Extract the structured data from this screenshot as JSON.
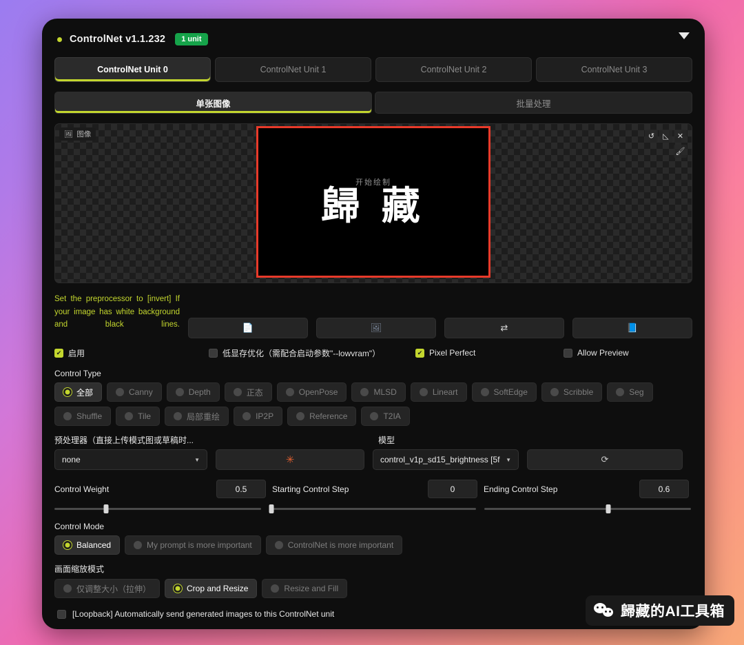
{
  "header": {
    "title": "ControlNet v1.1.232",
    "badge": "1 unit",
    "status_dot_color": "#c3d62e",
    "collapse_icon": "chevron-down-icon"
  },
  "unit_tabs": [
    {
      "label": "ControlNet Unit 0",
      "active": true
    },
    {
      "label": "ControlNet Unit 1",
      "active": false
    },
    {
      "label": "ControlNet Unit 2",
      "active": false
    },
    {
      "label": "ControlNet Unit 3",
      "active": false
    }
  ],
  "mode_tabs": [
    {
      "label": "单张图像",
      "active": true
    },
    {
      "label": "批量处理",
      "active": false
    }
  ],
  "image_area": {
    "tag_label": "图像",
    "tag_icon": "image-icon",
    "tools": [
      {
        "icon": "undo-icon",
        "glyph": "↺"
      },
      {
        "icon": "eraser-icon",
        "glyph": "◺"
      },
      {
        "icon": "close-icon",
        "glyph": "✕"
      },
      {
        "icon": "brush-icon",
        "glyph": "🖌"
      }
    ],
    "canvas": {
      "subtitle": "开始绘制",
      "title": "歸 藏",
      "border_color": "#e83a2a",
      "background": "#000000"
    }
  },
  "hint": "Set the preprocessor to [invert] If your image has white background and black lines.",
  "icon_buttons": [
    {
      "name": "upload-document-button",
      "glyph": "📄"
    },
    {
      "name": "camera-button",
      "glyph": "🖼"
    },
    {
      "name": "swap-button",
      "glyph": "⇄"
    },
    {
      "name": "send-to-button",
      "glyph": "📘"
    }
  ],
  "checkboxes": [
    {
      "label": "启用",
      "checked": true
    },
    {
      "label": "低显存优化（需配合启动参数\"--lowvram\"）",
      "checked": false
    },
    {
      "label": "Pixel Perfect",
      "checked": true
    },
    {
      "label": "Allow Preview",
      "checked": false
    }
  ],
  "control_type": {
    "label": "Control Type",
    "options_row1": [
      {
        "label": "全部",
        "selected": true
      },
      {
        "label": "Canny",
        "selected": false
      },
      {
        "label": "Depth",
        "selected": false
      },
      {
        "label": "正态",
        "selected": false
      },
      {
        "label": "OpenPose",
        "selected": false
      },
      {
        "label": "MLSD",
        "selected": false
      },
      {
        "label": "Lineart",
        "selected": false
      },
      {
        "label": "SoftEdge",
        "selected": false
      },
      {
        "label": "Scribble",
        "selected": false
      },
      {
        "label": "Seg",
        "selected": false
      }
    ],
    "options_row2": [
      {
        "label": "Shuffle",
        "selected": false
      },
      {
        "label": "Tile",
        "selected": false
      },
      {
        "label": "局部重绘",
        "selected": false
      },
      {
        "label": "IP2P",
        "selected": false
      },
      {
        "label": "Reference",
        "selected": false
      },
      {
        "label": "T2IA",
        "selected": false
      }
    ]
  },
  "preprocessor": {
    "label": "预处理器（直接上传模式图或草稿时...",
    "value": "none"
  },
  "model": {
    "label": "模型",
    "value": "control_v1p_sd15_brightness [5f"
  },
  "run_button": {
    "name": "run-preprocessor-button",
    "glyph": "✳"
  },
  "refresh_button": {
    "name": "refresh-models-button",
    "glyph": "⟳"
  },
  "sliders": [
    {
      "label": "Control Weight",
      "value": "0.5",
      "percent": 25
    },
    {
      "label": "Starting Control Step",
      "value": "0",
      "percent": 0
    },
    {
      "label": "Ending Control Step",
      "value": "0.6",
      "percent": 60
    }
  ],
  "control_mode": {
    "label": "Control Mode",
    "options": [
      {
        "label": "Balanced",
        "selected": true
      },
      {
        "label": "My prompt is more important",
        "selected": false
      },
      {
        "label": "ControlNet is more important",
        "selected": false
      }
    ]
  },
  "resize_mode": {
    "label": "画面缩放模式",
    "options": [
      {
        "label": "仅调整大小（拉伸）",
        "selected": false
      },
      {
        "label": "Crop and Resize",
        "selected": true
      },
      {
        "label": "Resize and Fill",
        "selected": false
      }
    ]
  },
  "loopback": {
    "label": "[Loopback] Automatically send generated images to this ControlNet unit",
    "checked": false
  },
  "watermark": {
    "text": "歸藏的AI工具箱",
    "icon": "wechat-icon"
  },
  "colors": {
    "accent": "#c3d62e",
    "badge_green": "#16a34a",
    "panel_bg": "#0e0e0e",
    "canvas_border": "#e83a2a"
  }
}
